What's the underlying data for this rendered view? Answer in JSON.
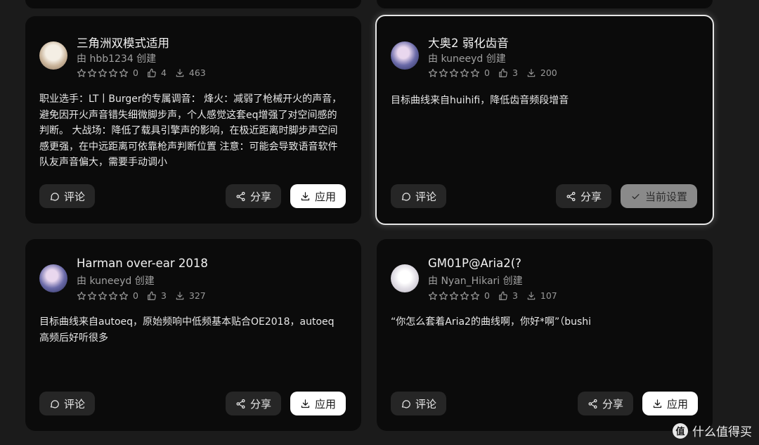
{
  "cards": [
    {
      "title": "三角洲双模式适用",
      "creator": "由 hbb1234 创建",
      "rating": "0",
      "likes": "4",
      "downloads": "463",
      "description": "职业选手：LT丨Burger的专属调音： 烽火：减弱了枪械开火的声音，避免因开火声音错失细微脚步声，个人感觉这套eq增强了对空间感的判断。 大战场：降低了载具引擎声的影响，在极近距离时脚步声空间感更强，在中远距离可依靠枪声判断位置 注意：可能会导致语音软件队友声音偏大，需要手动调小",
      "comment_label": "评论",
      "share_label": "分享",
      "action_label": "应用",
      "selected": false
    },
    {
      "title": "大奥2 弱化齿音",
      "creator": "由 kuneeyd 创建",
      "rating": "0",
      "likes": "3",
      "downloads": "200",
      "description": "目标曲线来自huihifi，降低齿音频段增音",
      "comment_label": "评论",
      "share_label": "分享",
      "action_label": "当前设置",
      "selected": true
    },
    {
      "title": "Harman over-ear 2018",
      "creator": "由 kuneeyd 创建",
      "rating": "0",
      "likes": "3",
      "downloads": "327",
      "description": "目标曲线来自autoeq，原始频响中低频基本贴合OE2018，autoeq高频后好听很多",
      "comment_label": "评论",
      "share_label": "分享",
      "action_label": "应用",
      "selected": false
    },
    {
      "title": "GM01P@Aria2(?",
      "creator": "由 Nyan_Hikari 创建",
      "rating": "0",
      "likes": "3",
      "downloads": "107",
      "description": "“你怎么套着Aria2的曲线啊，你好*啊”（bushi",
      "comment_label": "评论",
      "share_label": "分享",
      "action_label": "应用",
      "selected": false
    }
  ],
  "watermark": {
    "logo": "值",
    "text": "什么值得买"
  },
  "colors": {
    "background": "#1b1b1b",
    "card": "#0b0b0b",
    "selected_border": "#e6e6e6",
    "button_dark": "#262626",
    "button_white": "#ffffff",
    "button_current": "#8a8a8a"
  },
  "icons": [
    "star-outline-icon",
    "thumbs-up-icon",
    "download-icon",
    "comment-icon",
    "share-icon",
    "download-icon",
    "check-icon"
  ]
}
